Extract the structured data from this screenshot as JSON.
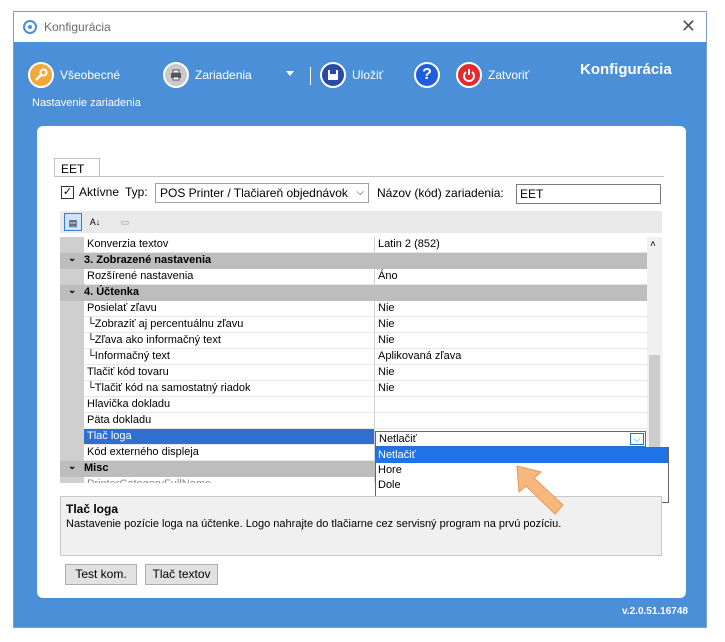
{
  "window": {
    "title": "Konfigurácia",
    "close_glyph": "✕",
    "version": "v.2.0.51.16748"
  },
  "toolbar": {
    "general_label": "Všeobecné",
    "devices_label": "Zariadenia",
    "save_label": "Uložiť",
    "close_label": "Zatvoriť",
    "page_title": "Konfigurácia",
    "subtitle": "Nastavenie zariadenia"
  },
  "tab": {
    "label": "EET"
  },
  "form": {
    "active_label": "Aktívne",
    "active_checked": true,
    "type_label": "Typ:",
    "type_value": "POS Printer / Tlačiareň objednávok",
    "device_name_label": "Názov (kód) zariadenia:",
    "device_name_value": "EET"
  },
  "grid": {
    "rows": [
      {
        "kind": "prop",
        "name": "Konverzia textov",
        "value": "Latin 2 (852)"
      },
      {
        "kind": "cat",
        "name": "3. Zobrazené nastavenia"
      },
      {
        "kind": "prop",
        "name": "Rozšírené nastavenia",
        "value": "Áno"
      },
      {
        "kind": "cat",
        "name": "4. Účtenka"
      },
      {
        "kind": "prop",
        "name": "Posielať zľavu",
        "value": "Nie"
      },
      {
        "kind": "prop",
        "name": "└Zobraziť aj percentuálnu zľavu",
        "value": "Nie"
      },
      {
        "kind": "prop",
        "name": "└Zľava ako informačný text",
        "value": "Nie"
      },
      {
        "kind": "prop",
        "name": "└Informačný text",
        "value": "Aplikovaná zľava"
      },
      {
        "kind": "prop",
        "name": "Tlačiť kód tovaru",
        "value": "Nie"
      },
      {
        "kind": "prop",
        "name": "└Tlačiť kód na samostatný riadok",
        "value": "Nie"
      },
      {
        "kind": "prop",
        "name": "Hlavička dokladu",
        "value": ""
      },
      {
        "kind": "prop",
        "name": "Päta dokladu",
        "value": ""
      },
      {
        "kind": "prop",
        "name": "Tlač loga",
        "value": "",
        "selected": true
      },
      {
        "kind": "prop",
        "name": "Kód externého displeja",
        "value": ""
      },
      {
        "kind": "cat",
        "name": "Misc"
      },
      {
        "kind": "prop",
        "name": "PrinterCategoryFullName",
        "value": "",
        "greyed": true
      }
    ],
    "editor_value": "Netlačiť",
    "dropdown_options": [
      "Netlačiť",
      "Hore",
      "Dole"
    ]
  },
  "description": {
    "title": "Tlač loga",
    "text": "Nastavenie pozície loga na účtenke. Logo nahrajte do tlačiarne cez servisný program na prvú pozíciu."
  },
  "buttons": {
    "test_label": "Test kom.",
    "print_label": "Tlač textov"
  },
  "colors": {
    "header_bg": "#4a8fd8",
    "selection": "#2f6fcf",
    "dropdown_active": "#1e73e8",
    "hint_arrow": "#f6b87c"
  }
}
